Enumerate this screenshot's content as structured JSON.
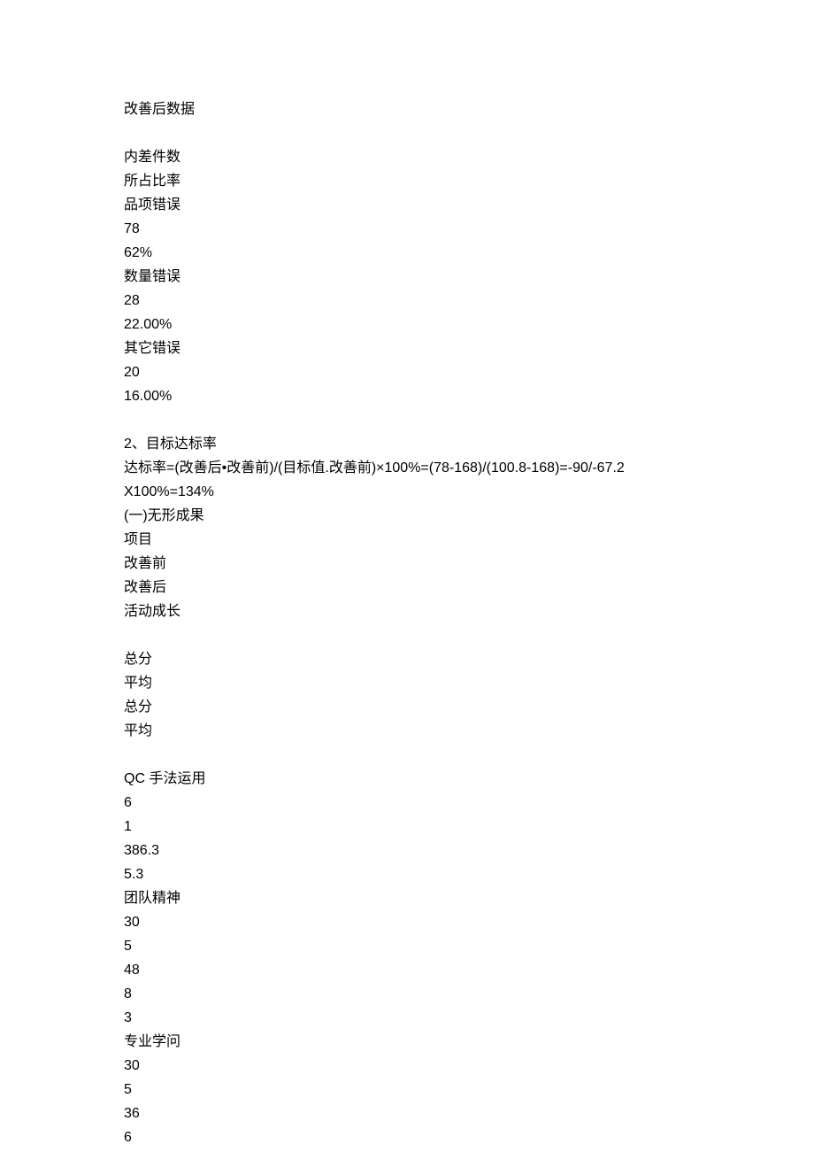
{
  "title": "改善后数据",
  "section1": {
    "lines": [
      "内差件数",
      "所占比率",
      "品项错误",
      "78",
      "62%",
      "数量错误",
      "28",
      "22.00%",
      "其它错误",
      "20",
      "16.00%"
    ]
  },
  "section2": {
    "lines": [
      "2、目标达标率",
      "达标率=(改善后•改善前)/(目标值.改善前)×100%=(78-168)/(100.8-168)=-90/-67.2",
      "X100%=134%",
      "(一)无形成果",
      "项目",
      "改善前",
      "改善后",
      "活动成长"
    ]
  },
  "section3": {
    "lines": [
      "总分",
      "平均",
      "总分",
      "平均"
    ]
  },
  "section4": {
    "lines": [
      "QC 手法运用",
      "6",
      "1",
      "386.3",
      "5.3",
      "团队精神",
      "30",
      "5",
      "48",
      "8",
      "3",
      "专业学问",
      "30",
      "5",
      "36",
      "6"
    ]
  }
}
